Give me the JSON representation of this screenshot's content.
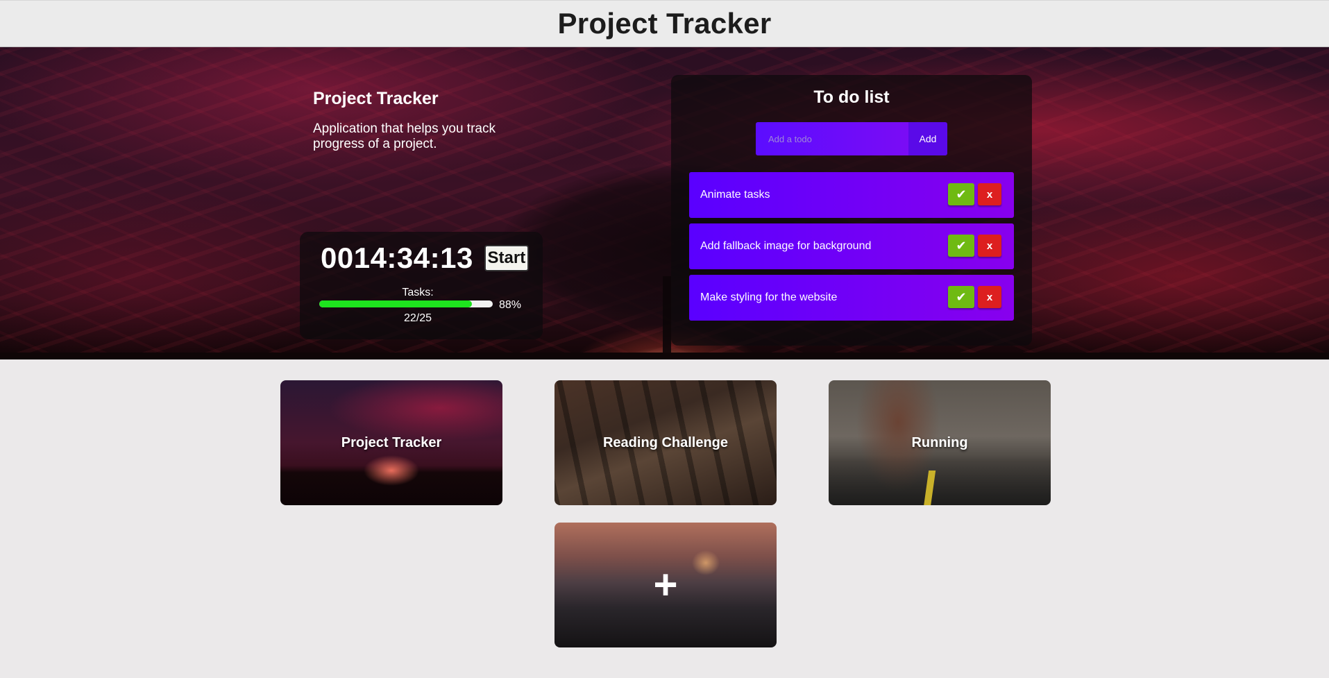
{
  "header": {
    "title": "Project Tracker"
  },
  "project": {
    "name": "Project Tracker",
    "description": "Application that helps you track progress of a project."
  },
  "timer": {
    "value": "0014:34:13",
    "start_label": "Start",
    "tasks_label": "Tasks:",
    "progress_fraction": 0.88,
    "progress_percent_label": "88%",
    "tasks_count": "22/25"
  },
  "todo": {
    "title": "To do list",
    "input_placeholder": "Add a todo",
    "input_value": "",
    "add_label": "Add",
    "done_symbol": "✔",
    "delete_symbol": "x",
    "items": [
      {
        "text": "Animate tasks"
      },
      {
        "text": "Add fallback image for background"
      },
      {
        "text": "Make styling for the website"
      }
    ]
  },
  "cards": [
    {
      "label": "Project Tracker"
    },
    {
      "label": "Reading Challenge"
    },
    {
      "label": "Running"
    },
    {
      "label": "+",
      "icon": "plus-icon"
    }
  ],
  "colors": {
    "todo_item": "#5a00ff",
    "done_button": "#6fba12",
    "delete_button": "#dd1f1f",
    "progress": "#1ee31e"
  }
}
